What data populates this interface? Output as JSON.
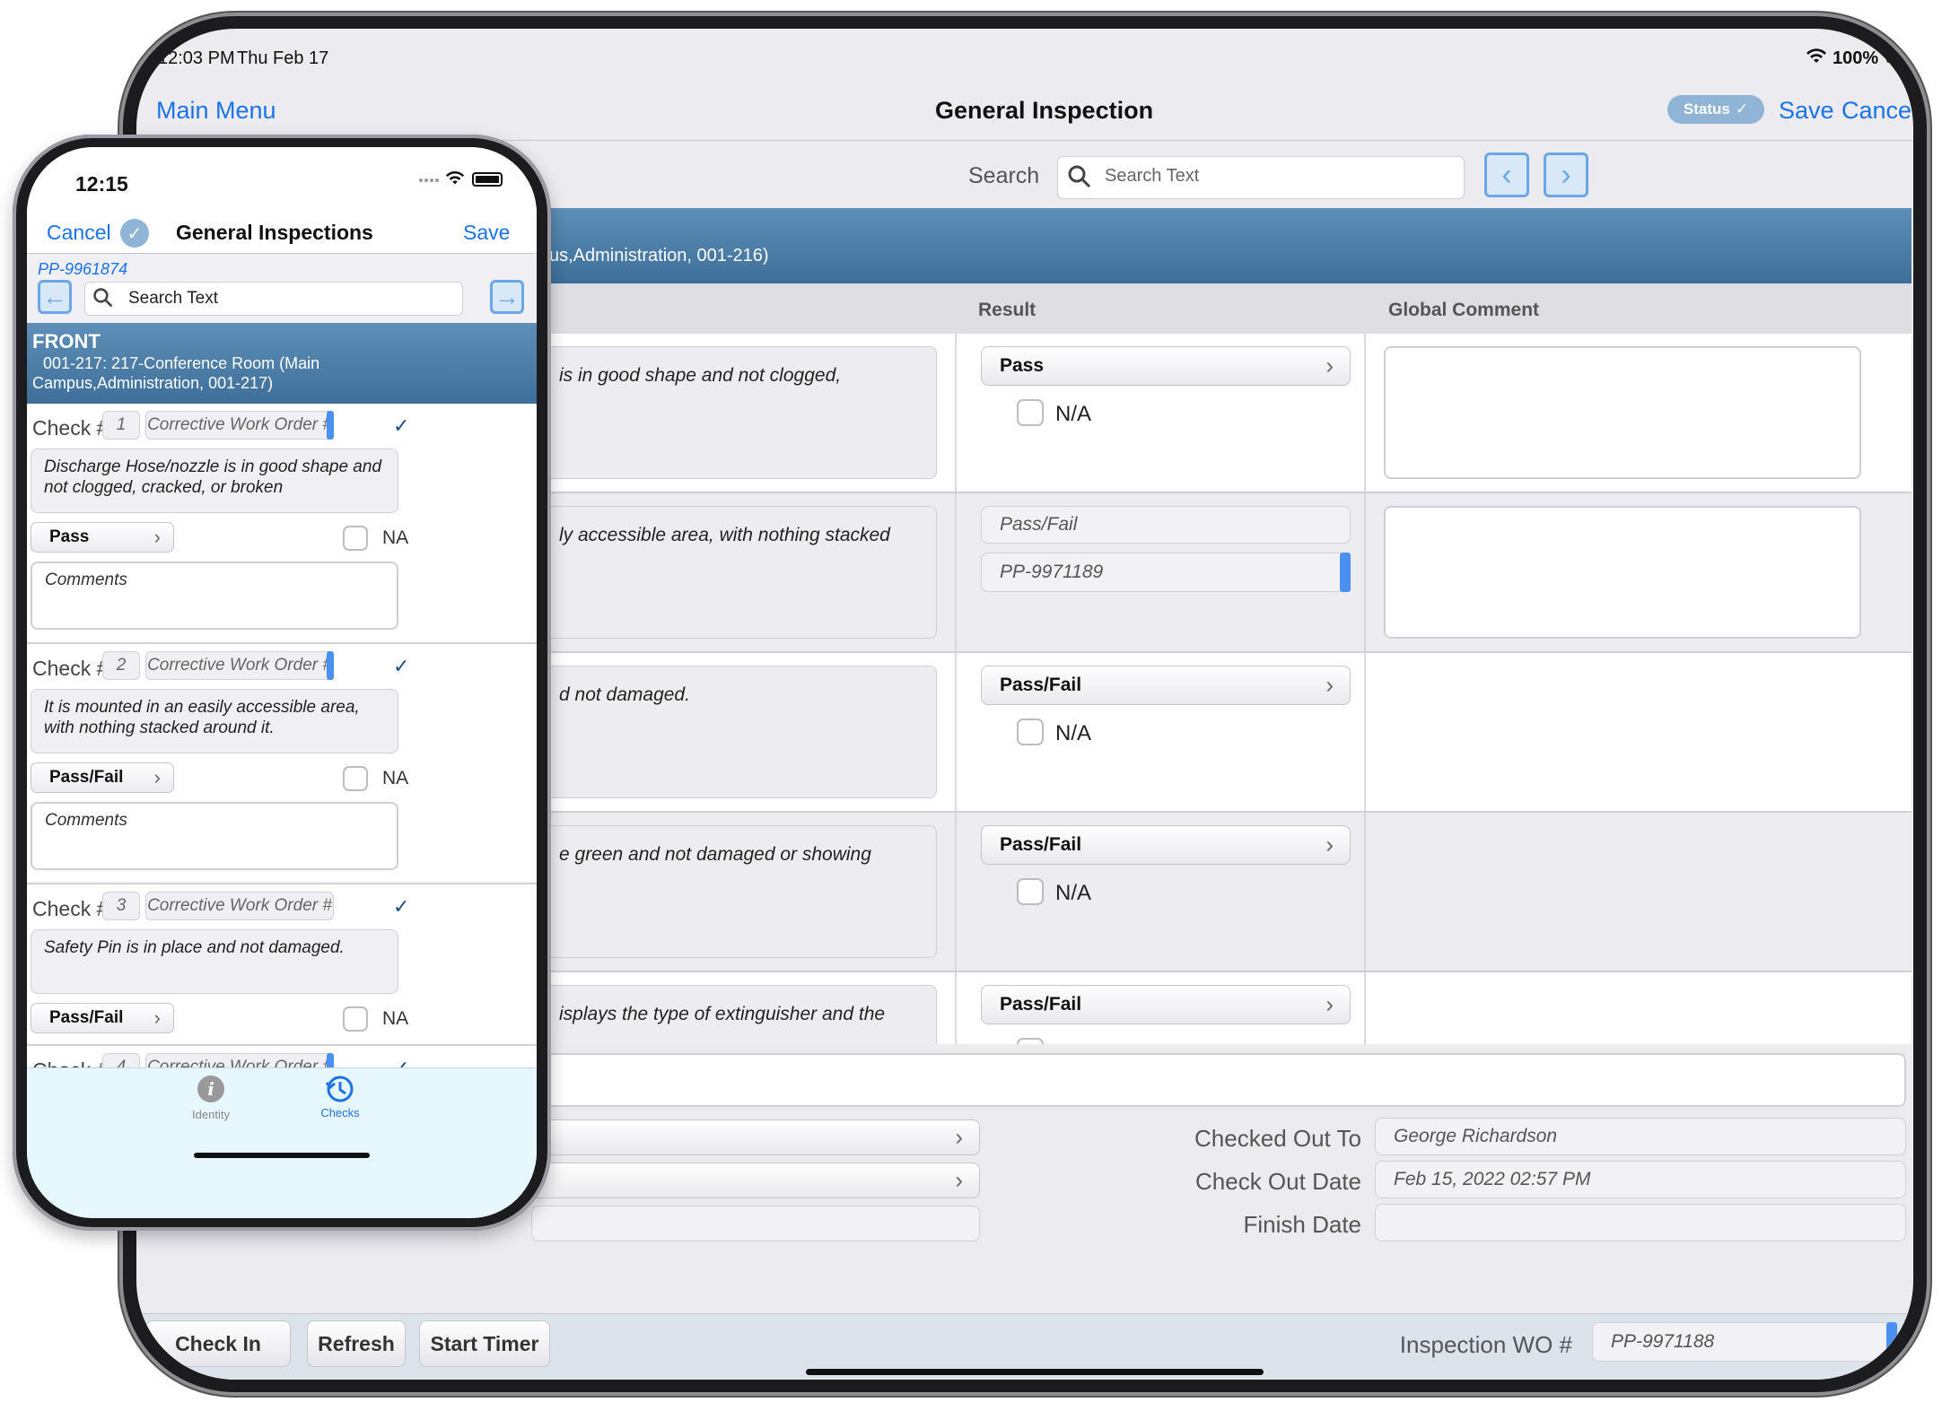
{
  "ipad": {
    "status_bar": {
      "time": "12:03 PM",
      "date": "Thu Feb 17",
      "battery": "100%"
    },
    "nav": {
      "main_menu": "Main Menu",
      "title": "General Inspection",
      "status_badge": "Status",
      "save": "Save",
      "cancel": "Cancel"
    },
    "search": {
      "label": "Search",
      "placeholder": "Search Text"
    },
    "section_subtitle": "us,Administration, 001-216)",
    "columns": {
      "result": "Result",
      "global_comment": "Global Comment"
    },
    "rows": [
      {
        "question": "is in good shape and not clogged,",
        "result": "Pass",
        "na": "N/A"
      },
      {
        "question": "ly accessible area, with nothing stacked",
        "result_placeholder": "Pass/Fail",
        "work_order": "PP-9971189"
      },
      {
        "question": "d not damaged.",
        "result": "Pass/Fail",
        "na": "N/A"
      },
      {
        "question": "e green and not damaged or showing",
        "result": "Pass/Fail",
        "na": "N/A"
      },
      {
        "question": "isplays the type of extinguisher and the",
        "result": "Pass/Fail"
      }
    ],
    "form": {
      "checked_out_to_label": "Checked Out To",
      "checked_out_to_value": "George Richardson",
      "check_out_date_label": "Check Out Date",
      "check_out_date_value": "Feb 15, 2022 02:57 PM",
      "finish_date_label": "Finish Date",
      "finish_date_value": ""
    },
    "bottom": {
      "check_in": "Check In",
      "refresh": "Refresh",
      "start_timer": "Start Timer",
      "inspection_wo_label": "Inspection WO #",
      "inspection_wo_value": "PP-9971188"
    }
  },
  "iphone": {
    "status_bar": {
      "time": "12:15"
    },
    "nav": {
      "cancel": "Cancel",
      "title": "General Inspections",
      "save": "Save"
    },
    "record_id": "PP-9961874",
    "search": {
      "placeholder": "Search Text"
    },
    "section": {
      "title": "FRONT",
      "subtitle": "001-217: 217-Conference Room  (Main Campus,Administration, 001-217)"
    },
    "check_label": "Check #",
    "cwo_placeholder": "Corrective Work Order #",
    "na_label": "NA",
    "comments_placeholder": "Comments",
    "checks": [
      {
        "num": "1",
        "question": "Discharge Hose/nozzle is in good shape and not clogged, cracked, or broken",
        "result": "Pass"
      },
      {
        "num": "2",
        "question": "It is mounted in an easily accessible area, with nothing stacked around it.",
        "result": "Pass/Fail"
      },
      {
        "num": "3",
        "question": "Safety Pin is in place and not damaged.",
        "result": "Pass/Fail"
      },
      {
        "num": "4"
      }
    ],
    "tabs": [
      {
        "label": "Identity"
      },
      {
        "label": "Checks"
      }
    ]
  }
}
